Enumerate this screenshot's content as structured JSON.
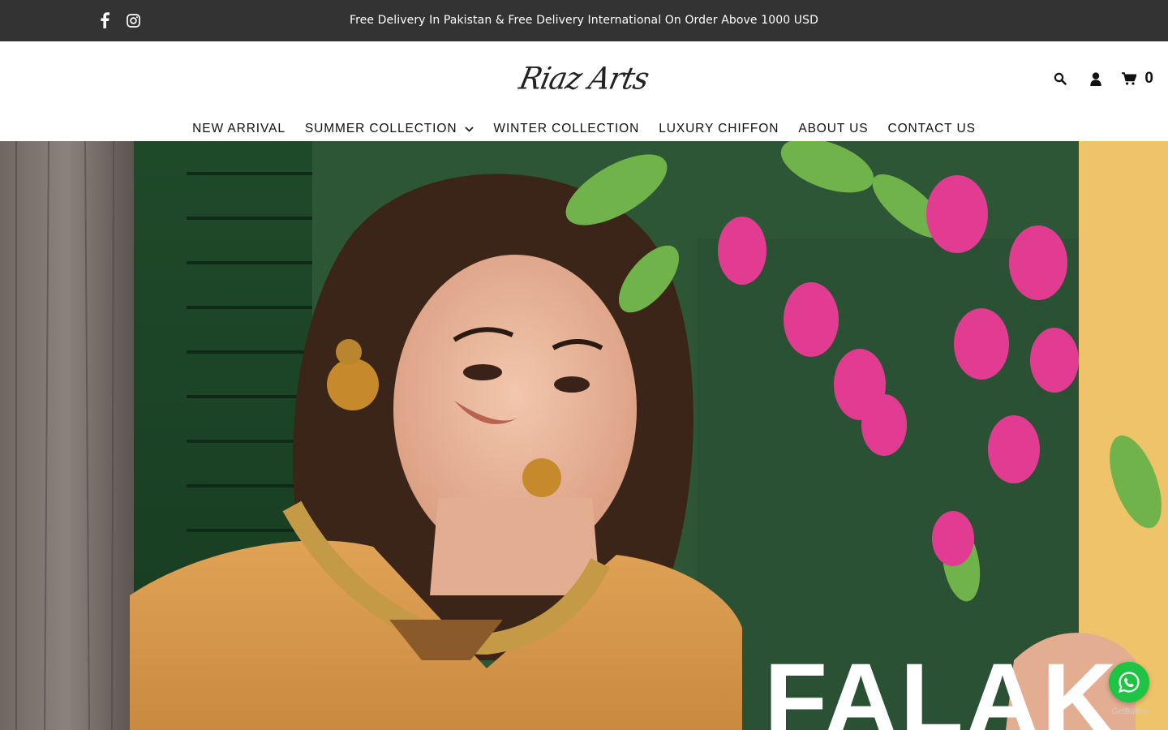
{
  "topbar": {
    "announcement": "Free Delivery In Pakistan & Free Delivery International On Order Above 1000 USD",
    "social_icons": [
      "facebook-icon",
      "instagram-icon"
    ]
  },
  "header": {
    "logo_text": "Riaz Arts",
    "icons": [
      "search-icon",
      "user-icon",
      "cart-icon"
    ],
    "cart_count": "0"
  },
  "nav": {
    "items": [
      {
        "label": "NEW ARRIVAL"
      },
      {
        "label": "SUMMER COLLECTION",
        "has_dropdown": true
      },
      {
        "label": "WINTER COLLECTION"
      },
      {
        "label": "LUXURY CHIFFON"
      },
      {
        "label": "ABOUT US"
      },
      {
        "label": "CONTACT US"
      }
    ]
  },
  "hero": {
    "title": "FALAK"
  },
  "whatsapp": {
    "icon": "whatsapp-icon",
    "credit": "GetButton"
  },
  "colors": {
    "topbar_bg": "#333333",
    "whatsapp_green": "#1fc445",
    "nav_text": "#111111"
  }
}
